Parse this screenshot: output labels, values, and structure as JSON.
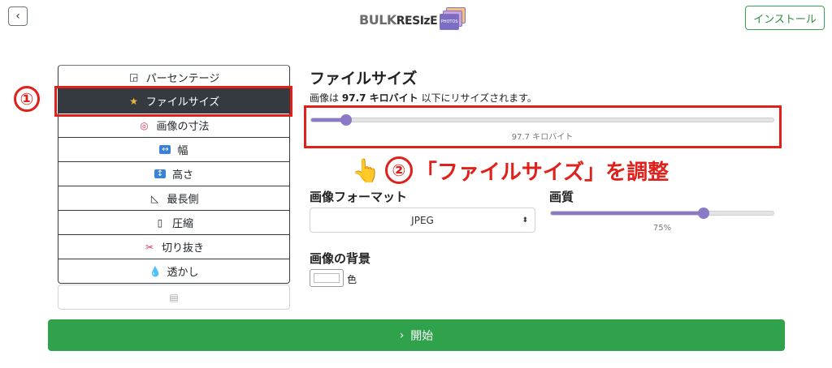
{
  "header": {
    "back_icon": "chevron-left-icon",
    "back_glyph": "‹",
    "logo": {
      "part1": "BULK",
      "part2": "RESIzE",
      "badge": "PHOTOS"
    },
    "install_label": "インストール"
  },
  "sidebar": {
    "items": [
      {
        "label": "パーセンテージ",
        "icon": "percent-icon",
        "glyph": "◲",
        "active": false
      },
      {
        "label": "ファイルサイズ",
        "icon": "star-icon",
        "glyph": "★",
        "active": true
      },
      {
        "label": "画像の寸法",
        "icon": "target-icon",
        "glyph": "◎",
        "active": false
      },
      {
        "label": "幅",
        "icon": "width-arrows-icon",
        "glyph": "↔",
        "active": false
      },
      {
        "label": "高さ",
        "icon": "height-arrows-icon",
        "glyph": "↕",
        "active": false
      },
      {
        "label": "最長側",
        "icon": "triangle-ruler-icon",
        "glyph": "◺",
        "active": false
      },
      {
        "label": "圧縮",
        "icon": "compress-icon",
        "glyph": "▯",
        "active": false
      },
      {
        "label": "切り抜き",
        "icon": "scissors-icon",
        "glyph": "✂",
        "active": false
      },
      {
        "label": "透かし",
        "icon": "droplet-icon",
        "glyph": "💧",
        "active": false
      }
    ],
    "extra_icon": "list-icon",
    "extra_glyph": "▤"
  },
  "filesize": {
    "heading": "ファイルサイズ",
    "desc_prefix": "画像は",
    "desc_value": "97.7 キロバイト",
    "desc_suffix": "以下にリサイズされます。",
    "slider_value_label": "97.7 キロバイト",
    "slider_fraction": 0.075
  },
  "annotations": {
    "num1": "①",
    "num2": "②",
    "instruction": "「ファイルサイズ」を調整",
    "hand_icon": "pointing-hand-icon",
    "hand_glyph": "👆",
    "color": "#e0201b"
  },
  "format": {
    "heading": "画像フォーマット",
    "selected": "JPEG",
    "caret": "⬍"
  },
  "quality": {
    "heading": "画質",
    "value_label": "75%",
    "fraction": 0.68
  },
  "background": {
    "heading": "画像の背景",
    "color_label": "色"
  },
  "start": {
    "label": "開始",
    "icon": "chevron-right-icon",
    "glyph": "›",
    "color": "#31a24c"
  }
}
